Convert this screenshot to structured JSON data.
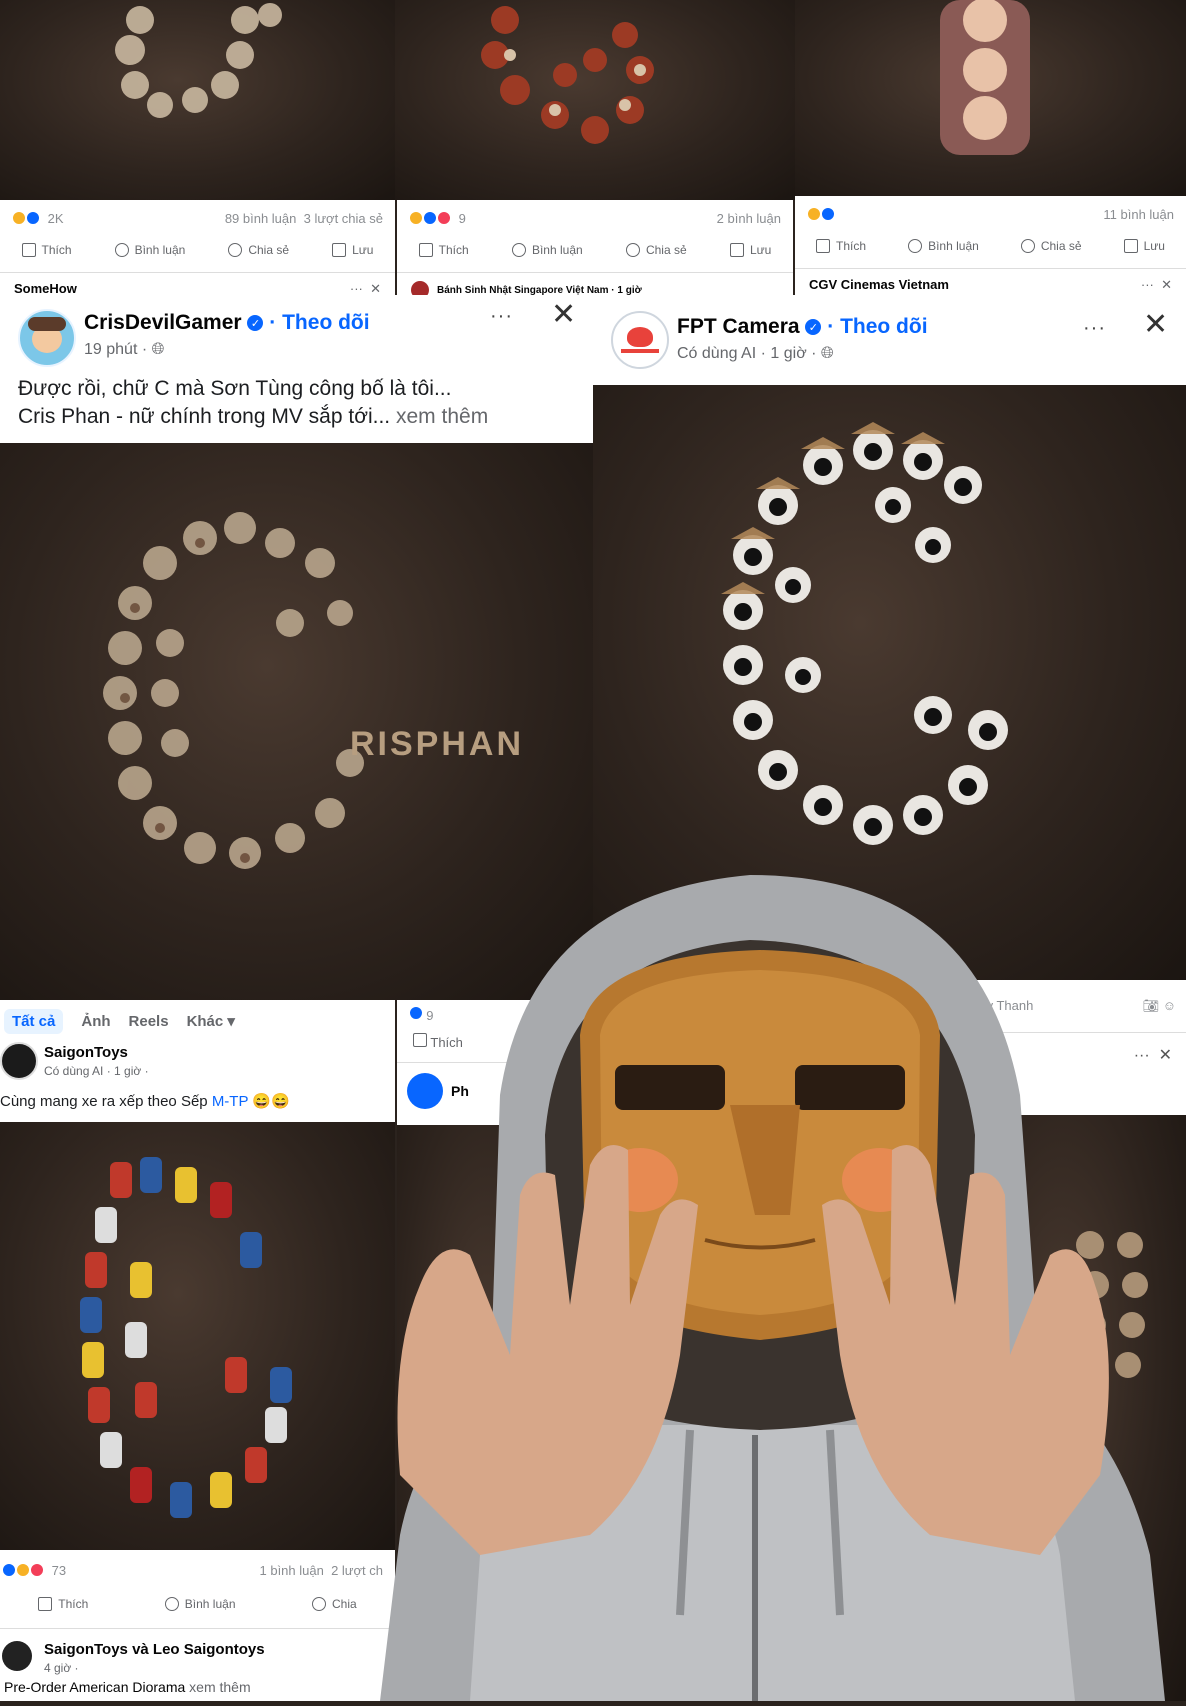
{
  "colors": {
    "fb_blue": "#0866ff",
    "muted": "#65676b",
    "bg_photo": "#2e241e"
  },
  "top_row": [
    {
      "reactions": "2K",
      "comments": "89 bình luận",
      "shares": "3 lượt chia sẻ",
      "like": "Thích",
      "comment": "Bình luận",
      "share": "Chia sẻ",
      "save": "Lưu",
      "next_page": "SomeHow"
    },
    {
      "reactions": "9",
      "comments": "2 bình luận",
      "like": "Thích",
      "comment": "Bình luận",
      "share": "Chia sẻ",
      "save": "Lưu",
      "next_page": "Bánh Sinh Nhật Singapore Việt Nam · 1 giờ"
    },
    {
      "reactions": "",
      "comments": "11 bình luận",
      "like": "Thích",
      "comment": "Bình luận",
      "share": "Chia sẻ",
      "save": "Lưu",
      "next_page": "CGV Cinemas Vietnam"
    }
  ],
  "post_cris": {
    "author": "CrisDevilGamer",
    "follow": "Theo dõi",
    "time": "19 phút ·",
    "text_line1": "Được rồi, chữ C mà Sơn Tùng công bố là tôi...",
    "text_line2": "Cris Phan - nữ chính trong MV sắp tới...",
    "see_more": "xem thêm",
    "image_label": "RISPHAN",
    "more_icon": "more-dots-icon",
    "close_icon": "close-icon"
  },
  "post_fpt": {
    "author": "FPT Camera",
    "follow": "Theo dõi",
    "time": "Có dùng AI · 1 giờ ·"
  },
  "saigon_toys": {
    "tabs": [
      "Tất cả",
      "Ảnh",
      "Reels",
      "Khác ▾"
    ],
    "author": "SaigonToys",
    "time": "Có dùng AI · 1 giờ ·",
    "text": "Cùng mang xe ra xếp theo Sếp",
    "mention": "M-TP",
    "reactions": "73",
    "comments": "1 bình luận",
    "shares": "2 lượt ch",
    "like": "Thích",
    "comment": "Bình luận",
    "share": "Chia",
    "next_author": "SaigonToys và Leo Saigontoys",
    "next_time": "4 giờ ·",
    "next_text": "Pre-Order American Diorama",
    "next_more": "xem thêm"
  },
  "middle_small": {
    "reactions": "9",
    "like": "Thích",
    "next_author": "Ph"
  },
  "right_small": {
    "comment_placeholder": "Duy Thanh"
  }
}
